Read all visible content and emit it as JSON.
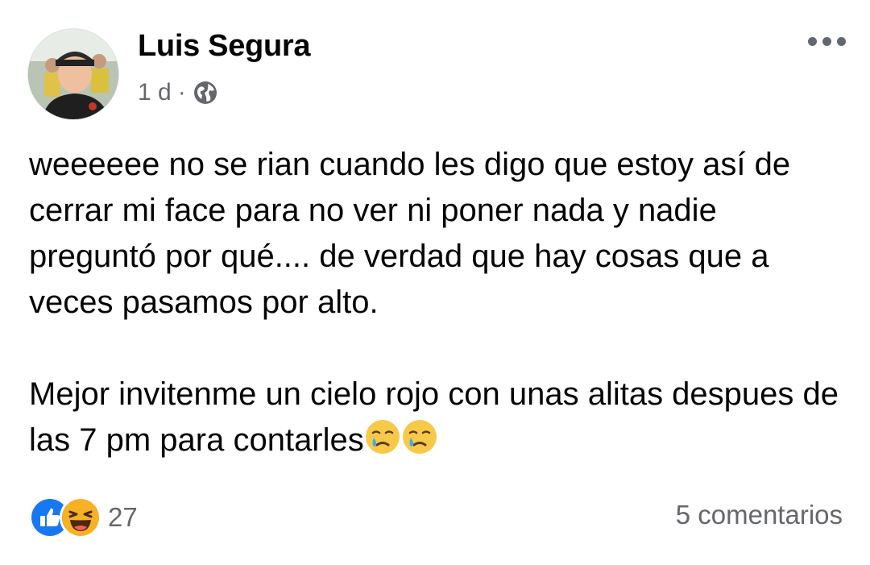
{
  "post": {
    "author": "Luis Segura",
    "time": "1 d",
    "separator": "·",
    "privacy_icon": "globe-icon",
    "paragraph1": "weeeeee no se rian cuando les digo que estoy así de cerrar mi face para no ver ni poner nada y nadie preguntó por qué....   de verdad que hay cosas que a veces pasamos por alto.",
    "paragraph2": "Mejor invitenme un cielo rojo con unas alitas despues de las 7 pm para contarles",
    "trailing_emojis": [
      "crying-face-emoji",
      "crying-face-emoji"
    ]
  },
  "reactions": {
    "icons": [
      "like-icon",
      "haha-icon"
    ],
    "count": "27"
  },
  "comments_label": "5 comentarios",
  "colors": {
    "like_blue": "#1877f2",
    "secondary_text": "#65676b",
    "emoji_yellow": "#f7c948"
  }
}
